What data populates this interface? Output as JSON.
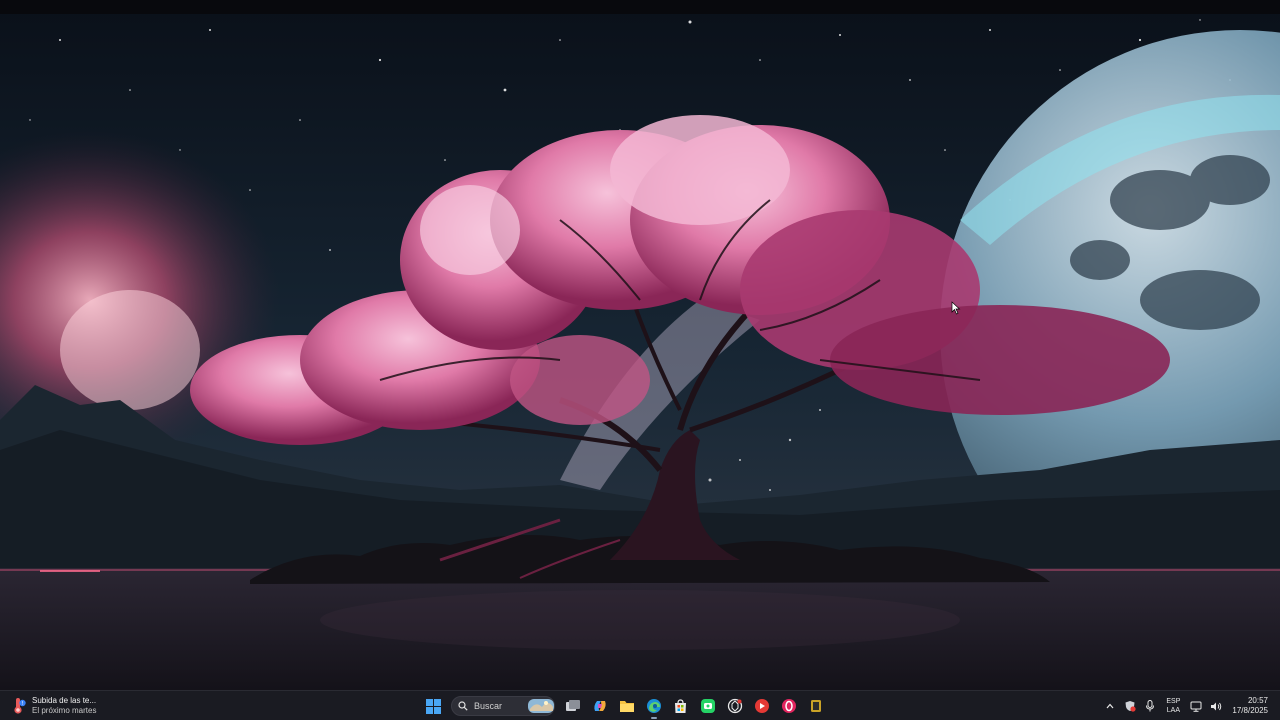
{
  "wallpaper": {
    "description_icon": "cherry-blossom-tree-wallpaper",
    "colors": {
      "sky_top": "#0b1220",
      "sky_mid": "#1b2a3a",
      "blossom": "#e07aa8",
      "blossom_dark": "#9c2f62",
      "planet": "#8fb3c8",
      "water": "#1c1a24"
    }
  },
  "taskbar": {
    "widget": {
      "title": "Subida de las te...",
      "subtitle": "El próximo martes",
      "icon": "weather-thermometer-icon"
    },
    "search": {
      "label": "Buscar",
      "icon": "search-icon"
    },
    "apps": [
      {
        "name": "start-icon"
      },
      {
        "name": "task-view-icon"
      },
      {
        "name": "copilot-icon"
      },
      {
        "name": "file-explorer-icon"
      },
      {
        "name": "edge-icon"
      },
      {
        "name": "microsoft-store-icon"
      },
      {
        "name": "whatsapp-icon"
      },
      {
        "name": "chatgpt-icon"
      },
      {
        "name": "youtube-icon"
      },
      {
        "name": "opera-icon"
      },
      {
        "name": "app-icon"
      }
    ],
    "tray": {
      "language_top": "ESP",
      "language_bottom": "LAA",
      "time": "20:57",
      "date": "17/8/2025"
    },
    "colors": {
      "background": "#1a1b22",
      "text": "#e8e8e8"
    }
  }
}
